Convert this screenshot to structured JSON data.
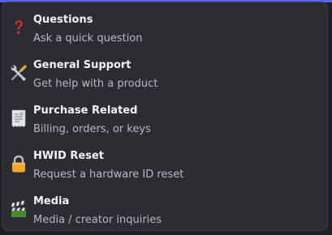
{
  "colors": {
    "menu_bg": "#2b2d33",
    "title": "#f2f3f5",
    "description": "#b5bac1",
    "accent": "#5865f2"
  },
  "menu": {
    "items": [
      {
        "title": "Questions",
        "description": "Ask a quick question",
        "icon": "question-mark-icon"
      },
      {
        "title": "General Support",
        "description": "Get help with a product",
        "icon": "tools-icon"
      },
      {
        "title": "Purchase Related",
        "description": "Billing, orders, or keys",
        "icon": "receipt-icon"
      },
      {
        "title": "HWID Reset",
        "description": "Request a hardware ID reset",
        "icon": "lock-icon"
      },
      {
        "title": "Media",
        "description": "Media / creator inquiries",
        "icon": "clapper-board-icon"
      }
    ]
  }
}
